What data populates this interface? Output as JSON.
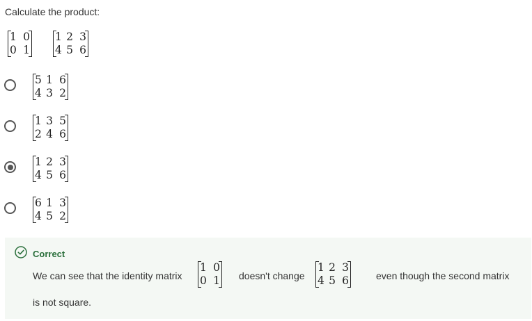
{
  "question": {
    "prompt": "Calculate the product:"
  },
  "question_matrices": [
    [
      [
        "1",
        "0"
      ],
      [
        "0",
        "1"
      ]
    ],
    [
      [
        "1",
        "2",
        "3"
      ],
      [
        "4",
        "5",
        "6"
      ]
    ]
  ],
  "options": [
    {
      "matrix": [
        [
          "5",
          "1",
          "6"
        ],
        [
          "4",
          "3",
          "2"
        ]
      ],
      "selected": false
    },
    {
      "matrix": [
        [
          "1",
          "3",
          "5"
        ],
        [
          "2",
          "4",
          "6"
        ]
      ],
      "selected": false
    },
    {
      "matrix": [
        [
          "1",
          "2",
          "3"
        ],
        [
          "4",
          "5",
          "6"
        ]
      ],
      "selected": true
    },
    {
      "matrix": [
        [
          "6",
          "1",
          "3"
        ],
        [
          "4",
          "5",
          "2"
        ]
      ],
      "selected": false
    }
  ],
  "feedback": {
    "status": "Correct",
    "text_1": "We can see that the identity matrix",
    "text_2": "doesn't change",
    "text_3": "even though the second matrix",
    "text_4": "is not square.",
    "matrix_1": [
      [
        "1",
        "0"
      ],
      [
        "0",
        "1"
      ]
    ],
    "matrix_2": [
      [
        "1",
        "2",
        "3"
      ],
      [
        "4",
        "5",
        "6"
      ]
    ]
  },
  "colors": {
    "correct_green": "#2a6f3b",
    "feedback_bg": "#f4f8f4",
    "radio": "#555555"
  }
}
